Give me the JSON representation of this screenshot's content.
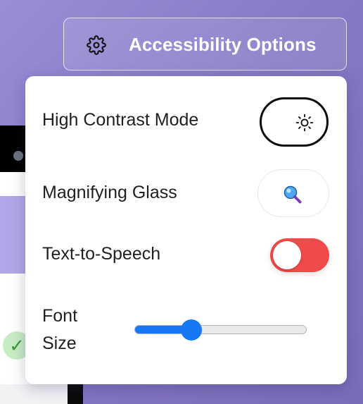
{
  "trigger": {
    "label": "Accessibility Options",
    "icon": "gear-icon"
  },
  "panel": {
    "high_contrast": {
      "label": "High Contrast Mode",
      "icon": "sun-icon",
      "enabled": false
    },
    "magnifier": {
      "label": "Magnifying Glass",
      "icon": "magnifying-glass-icon",
      "enabled": false
    },
    "tts": {
      "label": "Text-to-Speech",
      "enabled": false,
      "color": "#f04a4a"
    },
    "font_size": {
      "label_line1": "Font",
      "label_line2": "Size",
      "value_fraction": 0.33,
      "color": "#1778f5"
    }
  },
  "background": {
    "check_glyph": "✓"
  }
}
